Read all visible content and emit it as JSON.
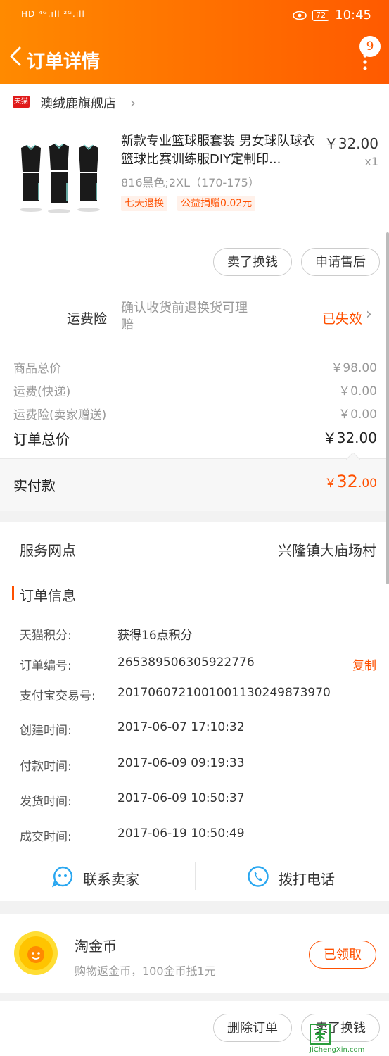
{
  "status_bar": {
    "left": "HD ⁴ᴳ.ıll ²ᴳ.ıll",
    "battery": "72",
    "time": "10:45"
  },
  "header": {
    "title": "订单详情",
    "badge": "9"
  },
  "shop": {
    "badge": "天猫",
    "name": "澳绒鹿旗舰店"
  },
  "product": {
    "title": "新款专业篮球服套装 男女球队球衣篮球比赛训练服DIY定制印...",
    "price": "￥32.00",
    "qty": "x1",
    "sku": "816黑色;2XL（170-175）",
    "tags": [
      "七天退换",
      "公益捐赠0.02元"
    ]
  },
  "actions": {
    "sell": "卖了换钱",
    "after_sale": "申请售后"
  },
  "insurance": {
    "label": "运费险",
    "desc": "确认收货前退换货可理赔",
    "status": "已失效"
  },
  "prices": {
    "goods_label": "商品总价",
    "goods_value": "￥98.00",
    "shipping_label": "运费(快递)",
    "shipping_value": "￥0.00",
    "ins_label": "运费险(卖家赠送)",
    "ins_value": "￥0.00",
    "total_label": "订单总价",
    "total_value": "￥32.00"
  },
  "paid": {
    "label": "实付款",
    "symbol": "￥",
    "int": "32",
    "dec": ".00"
  },
  "service": {
    "label": "服务网点",
    "value": "兴隆镇大庙场村"
  },
  "order_info": {
    "title": "订单信息",
    "rows": [
      {
        "label": "天猫积分:",
        "value": "获得16点积分"
      },
      {
        "label": "订单编号:",
        "value": "265389506305922776",
        "action": "复制"
      },
      {
        "label": "支付宝交易号:",
        "value": "2017060721001001130249873970"
      },
      {
        "label": "创建时间:",
        "value": "2017-06-07 17:10:32"
      },
      {
        "label": "付款时间:",
        "value": "2017-06-09 09:19:33"
      },
      {
        "label": "发货时间:",
        "value": "2017-06-09 10:50:37"
      },
      {
        "label": "成交时间:",
        "value": "2017-06-19 10:50:49"
      }
    ]
  },
  "contact": {
    "seller": "联系卖家",
    "phone": "拨打电话"
  },
  "coin": {
    "title": "淘金币",
    "desc": "购物返金币，100金币抵1元",
    "button": "已领取"
  },
  "footer": {
    "delete": "删除订单",
    "sell": "卖了换钱"
  },
  "watermark": "JiChengXin.com",
  "colors": {
    "accent": "#ff5000",
    "header_start": "#ff8a00",
    "header_end": "#ff5a00",
    "contact_icon": "#2aa7f0"
  }
}
